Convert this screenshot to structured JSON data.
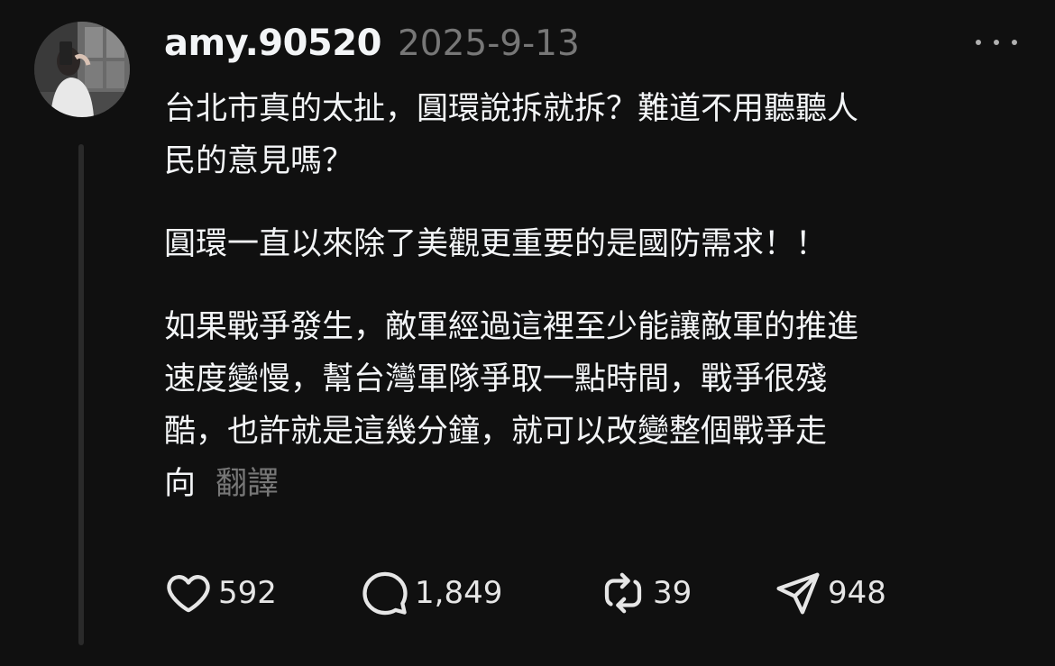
{
  "post": {
    "username": "amy.90520",
    "date": "2025-9-13",
    "paragraphs": [
      [
        "台北市真的太扯，圓環說拆就拆？難道不用聽聽人",
        "民的意見嗎？"
      ],
      [
        "圓環一直以來除了美觀更重要的是國防需求！！"
      ],
      [
        "如果戰爭發生，敵軍經過這裡至少能讓敵軍的推進",
        "速度變慢，幫台灣軍隊爭取一點時間，戰爭很殘",
        "酷，也許就是這幾分鐘，就可以改變整個戰爭走",
        "向"
      ]
    ],
    "translate_label": "翻譯"
  },
  "actions": {
    "likes": "592",
    "comments": "1,849",
    "reposts": "39",
    "shares": "948"
  },
  "icons": {
    "like": "heart-icon",
    "comment": "comment-bubble-icon",
    "repost": "repost-arrows-icon",
    "share": "send-plane-icon",
    "more": "more-dots-icon"
  },
  "colors": {
    "background": "#101010",
    "text_primary": "#f3f5f7",
    "text_secondary": "#777777"
  }
}
